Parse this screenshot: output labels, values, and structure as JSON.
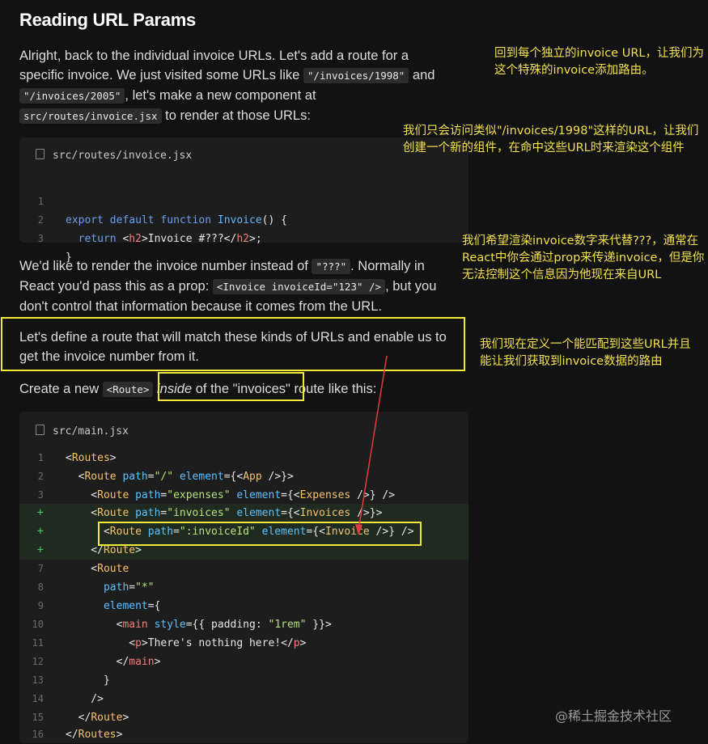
{
  "heading": "Reading URL Params",
  "p1": {
    "t1": "Alright, back to the individual invoice URLs. Let's add a route for a specific invoice. We just visited some URLs like ",
    "c1": "\"/invoices/1998\"",
    "t2": " and ",
    "c2": "\"/invoices/2005\"",
    "t3": ", let's make a new component at ",
    "c3": "src/routes/invoice.jsx",
    "t4": " to render at those URLs:"
  },
  "code1": {
    "filename": "src/routes/invoice.jsx",
    "lines": [
      {
        "n": "1",
        "export": "export",
        "default": "default",
        "function": "function",
        "name": "Invoice",
        "rest": "() {"
      },
      {
        "n": "2",
        "return": "return",
        "lt": "<",
        "h2": "h2",
        "text": ">Invoice #???</",
        "h2b": "h2",
        "end": ">;"
      },
      {
        "n": "3",
        "brace": "}"
      }
    ]
  },
  "p2": {
    "t1": "We'd like to render the invoice number instead of ",
    "c1": "\"???\"",
    "t2": ". Normally in React you'd pass this as a prop: ",
    "c2": "<Invoice invoiceId=\"123\" />",
    "t3": ", but you don't control that information because it comes from the URL."
  },
  "p3": "Let's define a route that will match these kinds of URLs and enable us to get the invoice number from it.",
  "p4": {
    "t1": "Create a new ",
    "c1": "<Route>",
    "em": "inside",
    "t2": " of the \"invoices\" route like this:"
  },
  "code2": {
    "filename": "src/main.jsx",
    "line_numbers": [
      "1",
      "2",
      "3",
      "4",
      "+",
      "+",
      "+",
      "7",
      "8",
      "9",
      "10",
      "11",
      "12",
      "13",
      "14",
      "15",
      "16"
    ],
    "tokens": {
      "routes": "Routes",
      "route": "Route",
      "path": "path",
      "element": "element",
      "app": "App",
      "expenses": "Expenses",
      "invoices": "Invoices",
      "invoice": "Invoice",
      "main": "main",
      "style": "style",
      "p": "p",
      "padding": "padding",
      "root_path": "\"/\"",
      "expenses_path": "\"expenses\"",
      "invoices_path": "\"invoices\"",
      "invoice_id_path": "\":invoiceId\"",
      "star_path": "\"*\"",
      "rem": "\"1rem\"",
      "nothing_here": "There's nothing here!"
    }
  },
  "annotations": {
    "a1": "回到每个独立的invoice URL，让我们为这个特殊的invoice添加路由。",
    "a2": "我们只会访问类似\"/invoices/1998\"这样的URL，让我们创建一个新的组件，在命中这些URL时来渲染这个组件",
    "a3": "我们希望渲染invoice数字来代替???，通常在React中你会通过prop来传递invoice，但是你无法控制这个信息因为他现在来自URL",
    "a4": "我们现在定义一个能匹配到这些URL并且能让我们获取到invoice数据的路由"
  },
  "watermark": "@稀土掘金技术社区",
  "colors": {
    "annotation": "#f2e14a",
    "highlight_box": "#f2e93b",
    "arrow": "#e23b3b",
    "added_line_bg": "#1f2a21"
  }
}
